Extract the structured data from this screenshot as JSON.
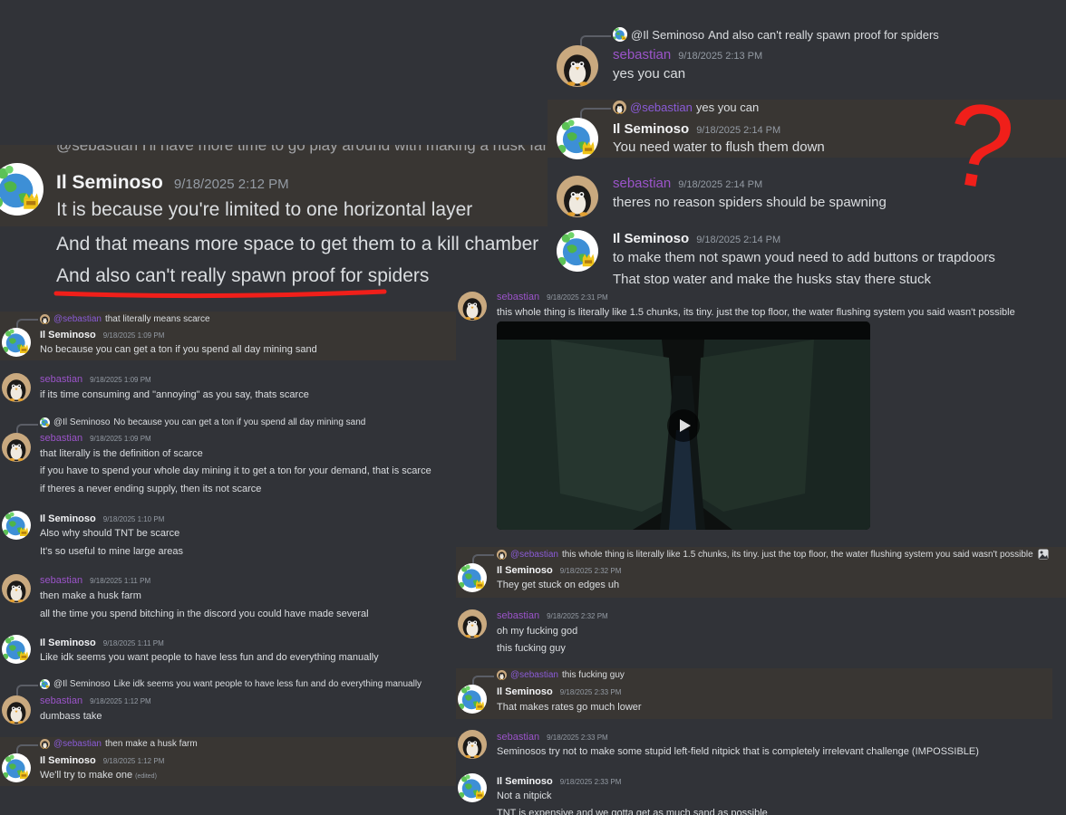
{
  "colors": {
    "bg": "#313338",
    "highlight": "#393633",
    "seb_name": "#9b54c9",
    "mention": "#8a5bd6",
    "annot_red": "#f01f1a"
  },
  "icons": {
    "play": "play-icon",
    "image": "image-icon",
    "avatar_seb": "penguin-avatar",
    "avatar_il": "globe-with-crown-avatar"
  },
  "top": {
    "m1": {
      "reply_user": "@Il Seminoso",
      "reply_text": "And also can't really spawn proof for spiders",
      "author": "sebastian",
      "ts": "9/18/2025 2:13 PM",
      "lines": [
        "yes you can"
      ]
    },
    "m2": {
      "reply_user": "@sebastian",
      "reply_text": "yes you can",
      "author": "Il Seminoso",
      "ts": "9/18/2025 2:14 PM",
      "lines": [
        "You need water to flush them down"
      ]
    },
    "m3": {
      "author": "sebastian",
      "ts": "9/18/2025 2:14 PM",
      "lines": [
        "theres no reason spiders should be spawning"
      ]
    },
    "m4": {
      "author": "Il Seminoso",
      "ts": "9/18/2025 2:14 PM",
      "lines": [
        "to make them not spawn youd need to add buttons or trapdoors",
        "That stop water and make the husks stay there stuck"
      ]
    },
    "question_mark": "?"
  },
  "zoom": {
    "reply_cut": "@sebastian  I'll have more time to go play around with making a husk farm",
    "author": "Il Seminoso",
    "ts": "9/18/2025 2:12 PM",
    "lines": [
      "It is because you're limited to one horizontal layer",
      "And that means more space to get them to a kill chamber",
      "And also can't really spawn proof for spiders"
    ]
  },
  "left": {
    "m1": {
      "reply_user": "@sebastian",
      "reply_text": "that literally means scarce",
      "author": "Il Seminoso",
      "ts": "9/18/2025 1:09 PM",
      "lines": [
        "No because you can get a ton if you spend all day mining sand"
      ]
    },
    "m2": {
      "author": "sebastian",
      "ts": "9/18/2025 1:09 PM",
      "lines": [
        "if its time consuming and \"annoying\" as you say, thats scarce"
      ]
    },
    "m3": {
      "reply_user": "@Il Seminoso",
      "reply_text": "No because you can get a ton if you spend all day mining sand",
      "author": "sebastian",
      "ts": "9/18/2025 1:09 PM",
      "lines": [
        "that literally is the definition of scarce",
        "if you have to spend your whole day mining it to get a ton for your demand, that is scarce",
        "if theres a never ending supply, then its not scarce"
      ]
    },
    "m4": {
      "author": "Il Seminoso",
      "ts": "9/18/2025 1:10 PM",
      "lines": [
        "Also why should TNT be scarce",
        "It's so useful to mine large areas"
      ]
    },
    "m5": {
      "author": "sebastian",
      "ts": "9/18/2025 1:11 PM",
      "lines": [
        "then make a husk farm",
        "all the time you spend bitching in the discord you could have made several"
      ]
    },
    "m6": {
      "author": "Il Seminoso",
      "ts": "9/18/2025 1:11 PM",
      "lines": [
        "Like idk seems you want people to have less fun and do everything manually"
      ]
    },
    "m7": {
      "reply_user": "@Il Seminoso",
      "reply_text": "Like idk seems you want people to have less fun and do everything manually",
      "author": "sebastian",
      "ts": "9/18/2025 1:12 PM",
      "lines": [
        "dumbass take"
      ]
    },
    "m8": {
      "reply_user": "@sebastian",
      "reply_text": "then make a husk farm",
      "author": "Il Seminoso",
      "ts": "9/18/2025 1:12 PM",
      "lines": [
        "We'll try to make one"
      ],
      "edited": "(edited)"
    }
  },
  "right": {
    "m1": {
      "author": "sebastian",
      "ts": "9/18/2025 2:31 PM",
      "lines": [
        "this whole thing is literally like 1.5 chunks, its tiny. just the top floor, the water flushing system you said wasn't possible"
      ]
    },
    "m2": {
      "reply_user": "@sebastian",
      "reply_text": "this whole thing is literally like 1.5 chunks, its tiny. just the top floor, the water flushing system you said wasn't possible",
      "author": "Il Seminoso",
      "ts": "9/18/2025 2:32 PM",
      "lines": [
        "They get stuck on edges uh"
      ]
    },
    "m3": {
      "author": "sebastian",
      "ts": "9/18/2025 2:32 PM",
      "lines": [
        "oh my fucking god",
        "this fucking guy"
      ]
    },
    "m4": {
      "reply_user": "@sebastian",
      "reply_text": "this fucking guy",
      "author": "Il Seminoso",
      "ts": "9/18/2025 2:33 PM",
      "lines": [
        "That makes rates go much lower"
      ]
    },
    "m5": {
      "author": "sebastian",
      "ts": "9/18/2025 2:33 PM",
      "lines": [
        "Seminosos try not to make some stupid left-field nitpick that is completely irrelevant challenge (IMPOSSIBLE)"
      ]
    },
    "m6": {
      "author": "Il Seminoso",
      "ts": "9/18/2025 2:33 PM",
      "lines": [
        "Not a nitpick",
        "TNT is expensive and we gotta get as much sand as possible"
      ]
    }
  }
}
